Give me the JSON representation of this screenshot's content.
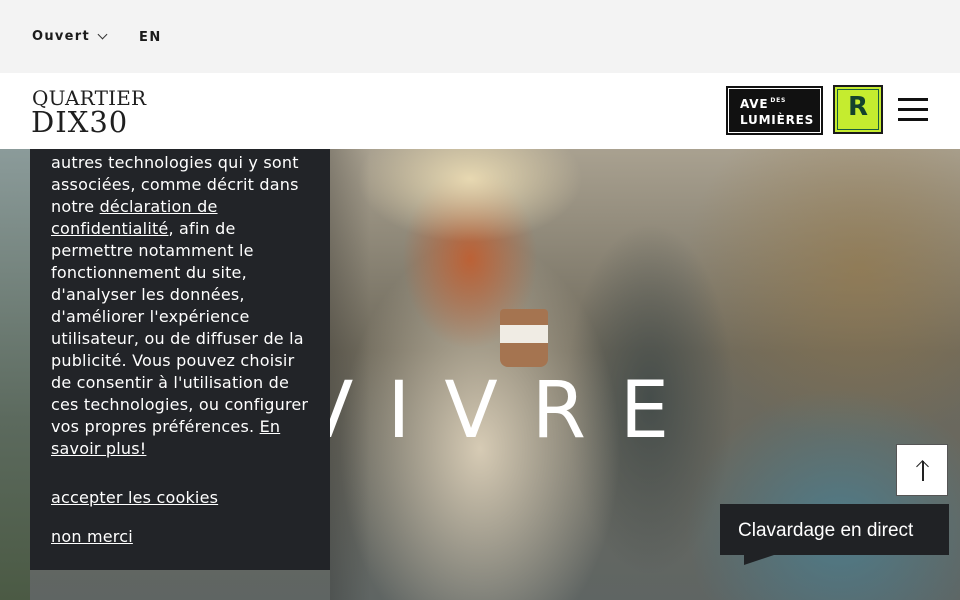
{
  "topbar": {
    "status": "Ouvert",
    "language": "EN"
  },
  "header": {
    "logo_line1": "QUARTIER",
    "logo_line2": "DIX30",
    "ave_line1": "AVE",
    "ave_small": "DES",
    "ave_line2": "LUMIÈRES",
    "r_badge": "R"
  },
  "hero": {
    "word": "VIVRE"
  },
  "cookie": {
    "text_before_link": "autres technologies qui y sont associées, comme décrit dans notre ",
    "privacy_link": "déclaration de confidentialité",
    "text_after_link": ", afin de permettre notamment le fonctionnement du site, d'analyser les données, d'améliorer l'expérience utilisateur, ou de diffuser de la publicité. Vous pouvez choisir de consentir à l'utilisation de ces technologies, ou configurer vos propres préférences. ",
    "learn_more": "En savoir plus!",
    "accept": "accepter les cookies",
    "decline": "non merci"
  },
  "chat": {
    "label": "Clavardage en direct"
  },
  "colors": {
    "accent_green": "#c5ec2f",
    "dark": "#222428"
  },
  "icons": {
    "menu": "hamburger-menu-icon",
    "scroll_top": "arrow-up-icon",
    "dropdown": "chevron-down-icon"
  }
}
